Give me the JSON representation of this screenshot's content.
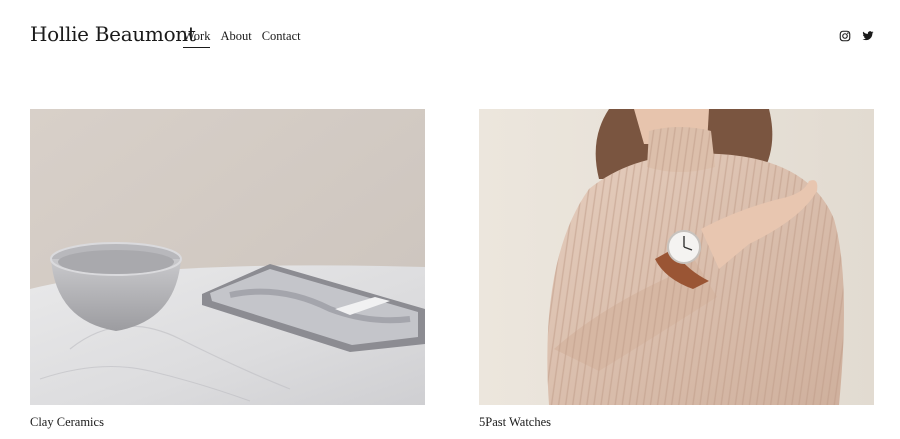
{
  "site": {
    "title": "Hollie Beaumont"
  },
  "nav": {
    "items": [
      {
        "label": "Work",
        "active": true
      },
      {
        "label": "About",
        "active": false
      },
      {
        "label": "Contact",
        "active": false
      }
    ]
  },
  "social": {
    "icons": [
      "instagram-icon",
      "twitter-icon"
    ]
  },
  "projects": [
    {
      "title": "Clay Ceramics"
    },
    {
      "title": "5Past Watches"
    }
  ],
  "colors": {
    "text": "#1a1a1a",
    "background": "#ffffff",
    "ceramics_wall": "#d3cbc4",
    "sweater": "#dcc1b0"
  }
}
